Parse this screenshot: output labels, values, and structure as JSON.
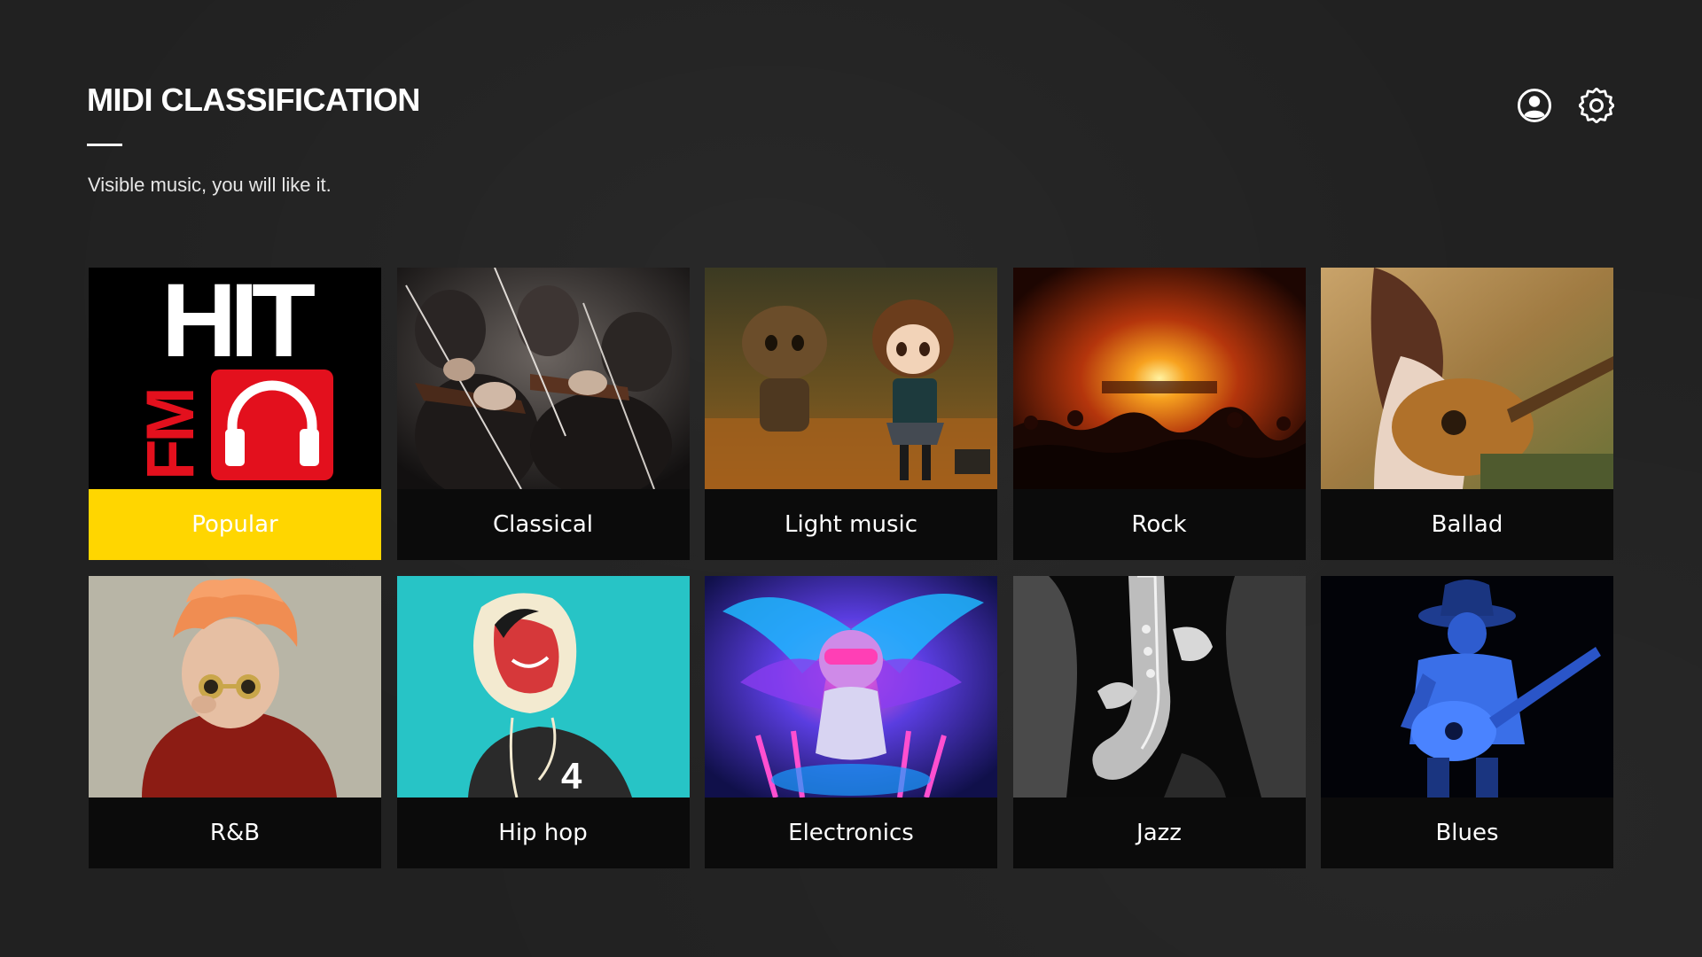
{
  "header": {
    "title": "MIDI CLASSIFICATION",
    "subtitle": "Visible music, you will like it."
  },
  "toolbar": {
    "icons": [
      "user-icon",
      "settings-icon"
    ]
  },
  "colors": {
    "background": "#212121",
    "accent": "#ffd600",
    "label_bg": "#0b0b0b",
    "hitfm_red": "#e3101d"
  },
  "categories": [
    {
      "label": "Popular",
      "art": "hit-fm-logo",
      "selected": true
    },
    {
      "label": "Classical",
      "art": "orchestra-violins-photo",
      "selected": false
    },
    {
      "label": "Light music",
      "art": "anime-figurines-photo",
      "selected": false
    },
    {
      "label": "Rock",
      "art": "concert-crowd-photo",
      "selected": false
    },
    {
      "label": "Ballad",
      "art": "acoustic-guitar-girl-photo",
      "selected": false
    },
    {
      "label": "R&B",
      "art": "orange-hair-singer-photo",
      "selected": false
    },
    {
      "label": "Hip hop",
      "art": "hip-hop-illustration",
      "selected": false
    },
    {
      "label": "Electronics",
      "art": "neon-dj-character-art",
      "selected": false
    },
    {
      "label": "Jazz",
      "art": "saxophone-player-photo",
      "selected": false
    },
    {
      "label": "Blues",
      "art": "blues-guitarist-photo",
      "selected": false
    }
  ],
  "logo": {
    "line1": "HIT",
    "line2": "FM"
  }
}
